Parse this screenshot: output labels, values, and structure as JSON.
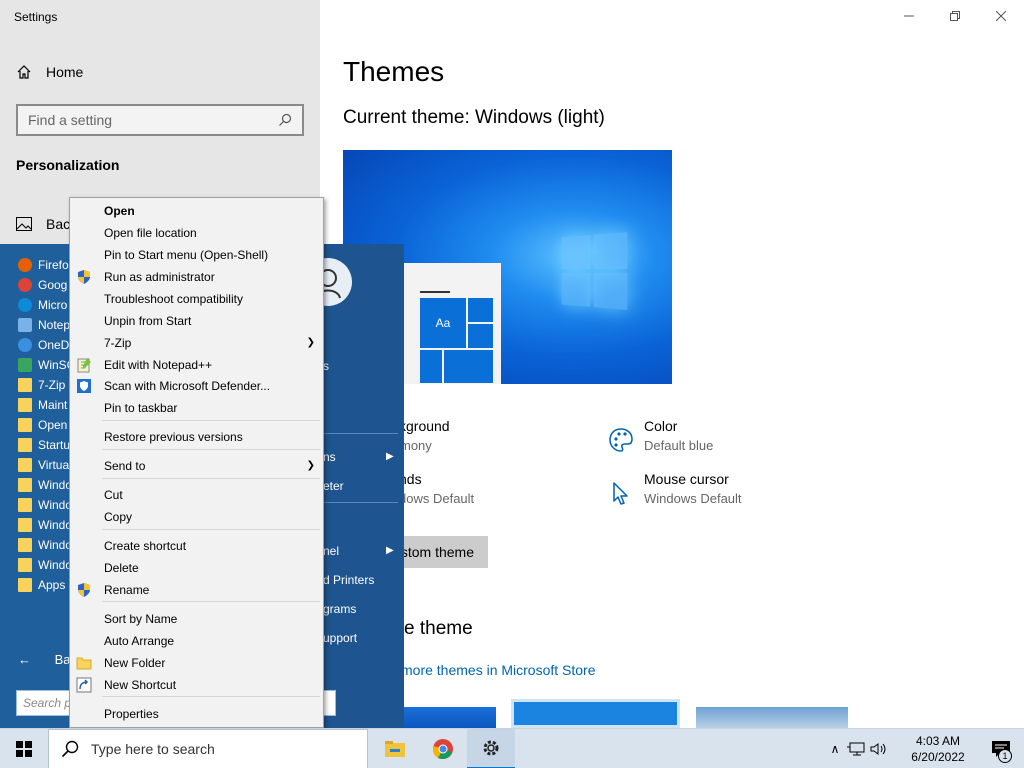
{
  "settings": {
    "app_title": "Settings",
    "home_label": "Home",
    "search_placeholder": "Find a setting",
    "section_title": "Personalization",
    "sidebar_item_background": "Bac"
  },
  "main": {
    "title": "Themes",
    "current_theme": "Current theme: Windows (light)",
    "preview_tile_label": "Aa",
    "items": [
      {
        "name": "kground",
        "sub": "mony"
      },
      {
        "name": "Color",
        "sub": "Default blue"
      },
      {
        "name": "nds",
        "sub": "dows Default"
      },
      {
        "name": "Mouse cursor",
        "sub": "Windows Default"
      }
    ],
    "custom_button": "stom theme",
    "apply_title": "e theme",
    "store_link": "more themes in Microsoft Store"
  },
  "startmenu": {
    "programs": [
      {
        "label": "Firefo",
        "icon": "firefox-icon"
      },
      {
        "label": "Goog",
        "icon": "chrome-icon"
      },
      {
        "label": "Micro",
        "icon": "edge-icon"
      },
      {
        "label": "Notep",
        "icon": "notepad-icon"
      },
      {
        "label": "OneD",
        "icon": "onedrive-icon"
      },
      {
        "label": "WinSC",
        "icon": "winscp-icon"
      },
      {
        "label": "7-Zip",
        "icon": "folder-icon"
      },
      {
        "label": "Maint",
        "icon": "folder-icon"
      },
      {
        "label": "Open",
        "icon": "folder-icon"
      },
      {
        "label": "Startu",
        "icon": "folder-icon"
      },
      {
        "label": "Virtua",
        "icon": "folder-icon"
      },
      {
        "label": "Windo",
        "icon": "folder-icon"
      },
      {
        "label": "Windo",
        "icon": "folder-icon"
      },
      {
        "label": "Windo",
        "icon": "folder-icon"
      },
      {
        "label": "Windo",
        "icon": "folder-icon"
      },
      {
        "label": "Windo",
        "icon": "folder-icon"
      },
      {
        "label": "Apps",
        "icon": "folder-icon"
      }
    ],
    "back_label": "Ba",
    "search_placeholder": "Search p",
    "right_items": [
      {
        "label": "ns",
        "arrow": true
      },
      {
        "label": "eter",
        "arrow": false
      },
      {
        "label": "nel",
        "arrow": true
      },
      {
        "label": "d Printers",
        "arrow": false
      },
      {
        "label": "grams",
        "arrow": false
      },
      {
        "label": "upport",
        "arrow": false
      }
    ],
    "right_stub": "s"
  },
  "context_menu": {
    "items": [
      {
        "label": "Open",
        "bold": true
      },
      {
        "label": "Open file location"
      },
      {
        "label": "Pin to Start menu (Open-Shell)"
      },
      {
        "label": "Run as administrator",
        "icon": "shield-icon"
      },
      {
        "label": "Troubleshoot compatibility"
      },
      {
        "label": "Unpin from Start"
      },
      {
        "label": "7-Zip",
        "submenu": true
      },
      {
        "label": "Edit with Notepad++",
        "icon": "notepadpp-icon"
      },
      {
        "label": "Scan with Microsoft Defender...",
        "icon": "defender-icon"
      },
      {
        "label": "Pin to taskbar"
      },
      {
        "label": "Restore previous versions"
      },
      {
        "label": "Send to",
        "submenu": true
      },
      {
        "label": "Cut"
      },
      {
        "label": "Copy"
      },
      {
        "label": "Create shortcut"
      },
      {
        "label": "Delete"
      },
      {
        "label": "Rename",
        "icon": "shield-icon"
      },
      {
        "label": "Sort by Name"
      },
      {
        "label": "Auto Arrange"
      },
      {
        "label": "New Folder",
        "icon": "folder-icon"
      },
      {
        "label": "New Shortcut",
        "icon": "shortcut-icon"
      },
      {
        "label": "Properties"
      }
    ]
  },
  "taskbar": {
    "search_placeholder": "Type here to search",
    "time": "4:03 AM",
    "date": "6/20/2022",
    "notification_count": "1"
  },
  "colors": {
    "accent": "#0078d7",
    "startmenu_bg": "#1c65a8",
    "link": "#0063b1"
  }
}
